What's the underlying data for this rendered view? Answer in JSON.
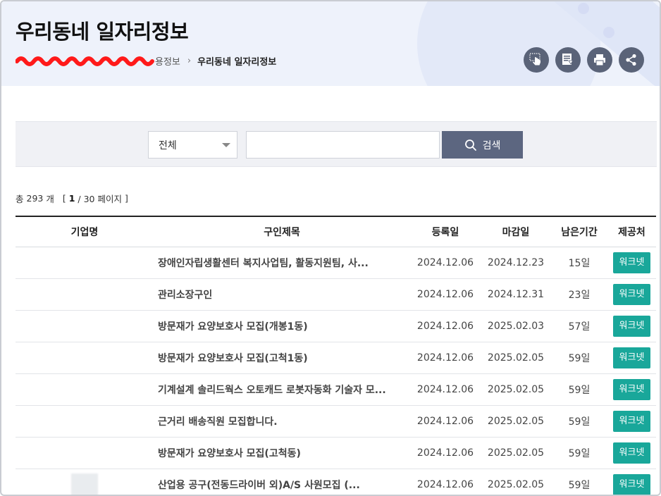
{
  "header": {
    "title": "우리동네 일자리정보",
    "breadcrumb": {
      "parent_visible": "용정보",
      "current": "우리동네 일자리정보"
    },
    "tool_icons": [
      "touch-icon",
      "bookmark-download-icon",
      "print-icon",
      "share-icon"
    ]
  },
  "search": {
    "category_selected": "전체",
    "query_value": "",
    "button_label": "검색"
  },
  "summary": {
    "total_prefix": "총",
    "total_count": "293",
    "total_suffix": "개",
    "open_bracket": "[",
    "current_page": "1",
    "page_sep": "/ 30 페이지",
    "close_bracket": "]"
  },
  "table": {
    "headers": {
      "company": "기업명",
      "title": "구인제목",
      "registered": "등록일",
      "deadline": "마감일",
      "remaining": "남은기간",
      "provider": "제공처"
    },
    "rows": [
      {
        "company": "",
        "title": "장애인자립생활센터 복지사업팀, 활동지원팀, 사...",
        "registered": "2024.12.06",
        "deadline": "2024.12.23",
        "remaining": "15일",
        "provider": "워크넷"
      },
      {
        "company": "",
        "title": "관리소장구인",
        "registered": "2024.12.06",
        "deadline": "2024.12.31",
        "remaining": "23일",
        "provider": "워크넷"
      },
      {
        "company": "",
        "title": "방문재가 요양보호사 모집(개봉1동)",
        "registered": "2024.12.06",
        "deadline": "2025.02.03",
        "remaining": "57일",
        "provider": "워크넷"
      },
      {
        "company": "",
        "title": "방문재가 요양보호사 모집(고척1동)",
        "registered": "2024.12.06",
        "deadline": "2025.02.05",
        "remaining": "59일",
        "provider": "워크넷"
      },
      {
        "company": "",
        "title": "기계설계 솔리드웍스 오토캐드 로봇자동화 기술자 모...",
        "registered": "2024.12.06",
        "deadline": "2025.02.05",
        "remaining": "59일",
        "provider": "워크넷"
      },
      {
        "company": "",
        "title": "근거리 배송직원 모집합니다.",
        "registered": "2024.12.06",
        "deadline": "2025.02.05",
        "remaining": "59일",
        "provider": "워크넷"
      },
      {
        "company": "",
        "title": "방문재가 요양보호사 모집(고척동)",
        "registered": "2024.12.06",
        "deadline": "2025.02.05",
        "remaining": "59일",
        "provider": "워크넷"
      },
      {
        "company": "",
        "title": "산업용 공구(전동드라이버 외)A/S 사원모집 (...",
        "registered": "2024.12.06",
        "deadline": "2025.02.05",
        "remaining": "59일",
        "provider": "워크넷"
      }
    ]
  },
  "colors": {
    "provider_badge": "#19a79a",
    "search_button": "#5c6680",
    "tool_button": "#5a6378",
    "redaction": "#ff1a1a"
  }
}
